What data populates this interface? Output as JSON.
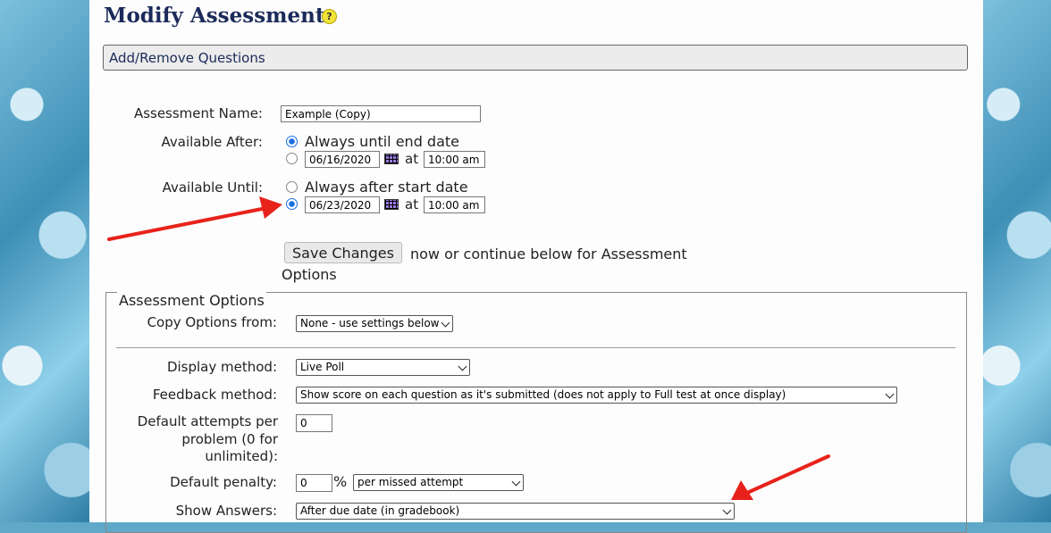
{
  "page": {
    "title": "Modify Assessment",
    "help_icon_text": "?",
    "add_remove_label": "Add/Remove Questions"
  },
  "form": {
    "assessment_name_label": "Assessment Name:",
    "assessment_name_value": "Example (Copy)",
    "available_after_label": "Available After:",
    "available_after_option1": "Always until end date",
    "available_after_date": "06/16/2020",
    "available_after_time": "10:00 am",
    "available_until_label": "Available Until:",
    "available_until_option1": "Always after start date",
    "available_until_date": "06/23/2020",
    "available_until_time": "10:00 am",
    "at_label": "at",
    "save_button": "Save Changes",
    "save_hint_line1": "now or continue below for Assessment",
    "save_hint_line2": "Options"
  },
  "options": {
    "legend": "Assessment Options",
    "copy_from_label": "Copy Options from:",
    "copy_from_value": "None - use settings below",
    "display_method_label": "Display method:",
    "display_method_value": "Live Poll",
    "feedback_method_label": "Feedback method:",
    "feedback_method_value": "Show score on each question as it's submitted (does not apply to Full test at once display)",
    "default_attempts_label_line1": "Default attempts per",
    "default_attempts_label_line2": "problem (0 for",
    "default_attempts_label_line3": "unlimited):",
    "default_attempts_value": "0",
    "default_penalty_label": "Default penalty:",
    "default_penalty_value": "0",
    "percent_sign": "%",
    "penalty_type_value": "per missed attempt",
    "show_answers_label": "Show Answers:",
    "show_answers_value": "After due date (in gradebook)"
  },
  "colors": {
    "title": "#1b2a5a",
    "arrow": "#e8221b",
    "radio_selected": "#1a6fe0"
  }
}
